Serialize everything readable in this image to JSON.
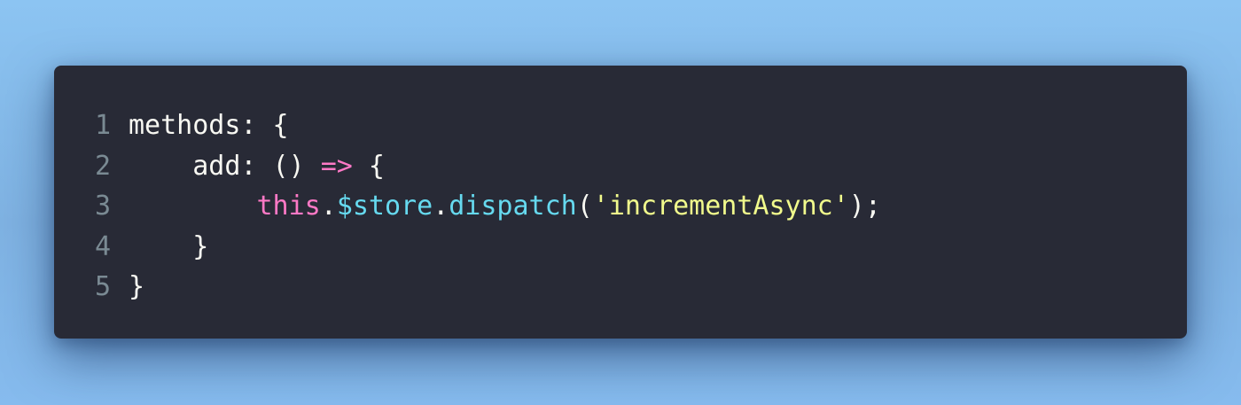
{
  "colors": {
    "background": "#8cc4f2",
    "editor_background": "#282a36",
    "line_number": "#7a8a93",
    "plain_text": "#f8f8f2",
    "keyword": "#ff79c6",
    "identifier": "#66d9ef",
    "string": "#f1fa8c"
  },
  "code": {
    "lines": [
      {
        "number": "1",
        "tokens": [
          {
            "text": "methods: {",
            "kind": "plain"
          }
        ]
      },
      {
        "number": "2",
        "tokens": [
          {
            "text": "    add: () ",
            "kind": "plain"
          },
          {
            "text": "=>",
            "kind": "operator"
          },
          {
            "text": " {",
            "kind": "plain"
          }
        ]
      },
      {
        "number": "3",
        "tokens": [
          {
            "text": "        ",
            "kind": "plain"
          },
          {
            "text": "this",
            "kind": "keyword"
          },
          {
            "text": ".",
            "kind": "plain"
          },
          {
            "text": "$store",
            "kind": "variable"
          },
          {
            "text": ".",
            "kind": "plain"
          },
          {
            "text": "dispatch",
            "kind": "function"
          },
          {
            "text": "(",
            "kind": "plain"
          },
          {
            "text": "'incrementAsync'",
            "kind": "string"
          },
          {
            "text": ");",
            "kind": "plain"
          }
        ]
      },
      {
        "number": "4",
        "tokens": [
          {
            "text": "    }",
            "kind": "plain"
          }
        ]
      },
      {
        "number": "5",
        "tokens": [
          {
            "text": "}",
            "kind": "plain"
          }
        ]
      }
    ]
  }
}
